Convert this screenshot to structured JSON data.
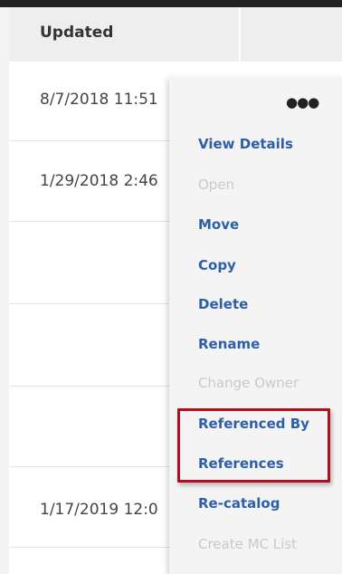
{
  "table": {
    "header": {
      "updated_label": "Updated"
    },
    "rows": [
      {
        "updated": "8/7/2018 11:51"
      },
      {
        "updated": "1/29/2018 2:46"
      },
      {
        "updated": ""
      },
      {
        "updated": ""
      },
      {
        "updated": ""
      },
      {
        "updated": ""
      },
      {
        "updated": "1/17/2019 12:0"
      }
    ]
  },
  "menu": {
    "more_icon": "more-options-icon",
    "items": [
      {
        "label": "View Details",
        "enabled": true
      },
      {
        "label": "Open",
        "enabled": false
      },
      {
        "label": "Move",
        "enabled": true
      },
      {
        "label": "Copy",
        "enabled": true
      },
      {
        "label": "Delete",
        "enabled": true
      },
      {
        "label": "Rename",
        "enabled": true
      },
      {
        "label": "Change Owner",
        "enabled": false
      },
      {
        "label": "Referenced By",
        "enabled": true
      },
      {
        "label": "References",
        "enabled": true
      },
      {
        "label": "Re-catalog",
        "enabled": true
      },
      {
        "label": "Create MC List",
        "enabled": false
      }
    ]
  },
  "colors": {
    "link": "#2c5fa8",
    "disabled": "#c9c9c9",
    "highlight": "#b10f1c"
  }
}
